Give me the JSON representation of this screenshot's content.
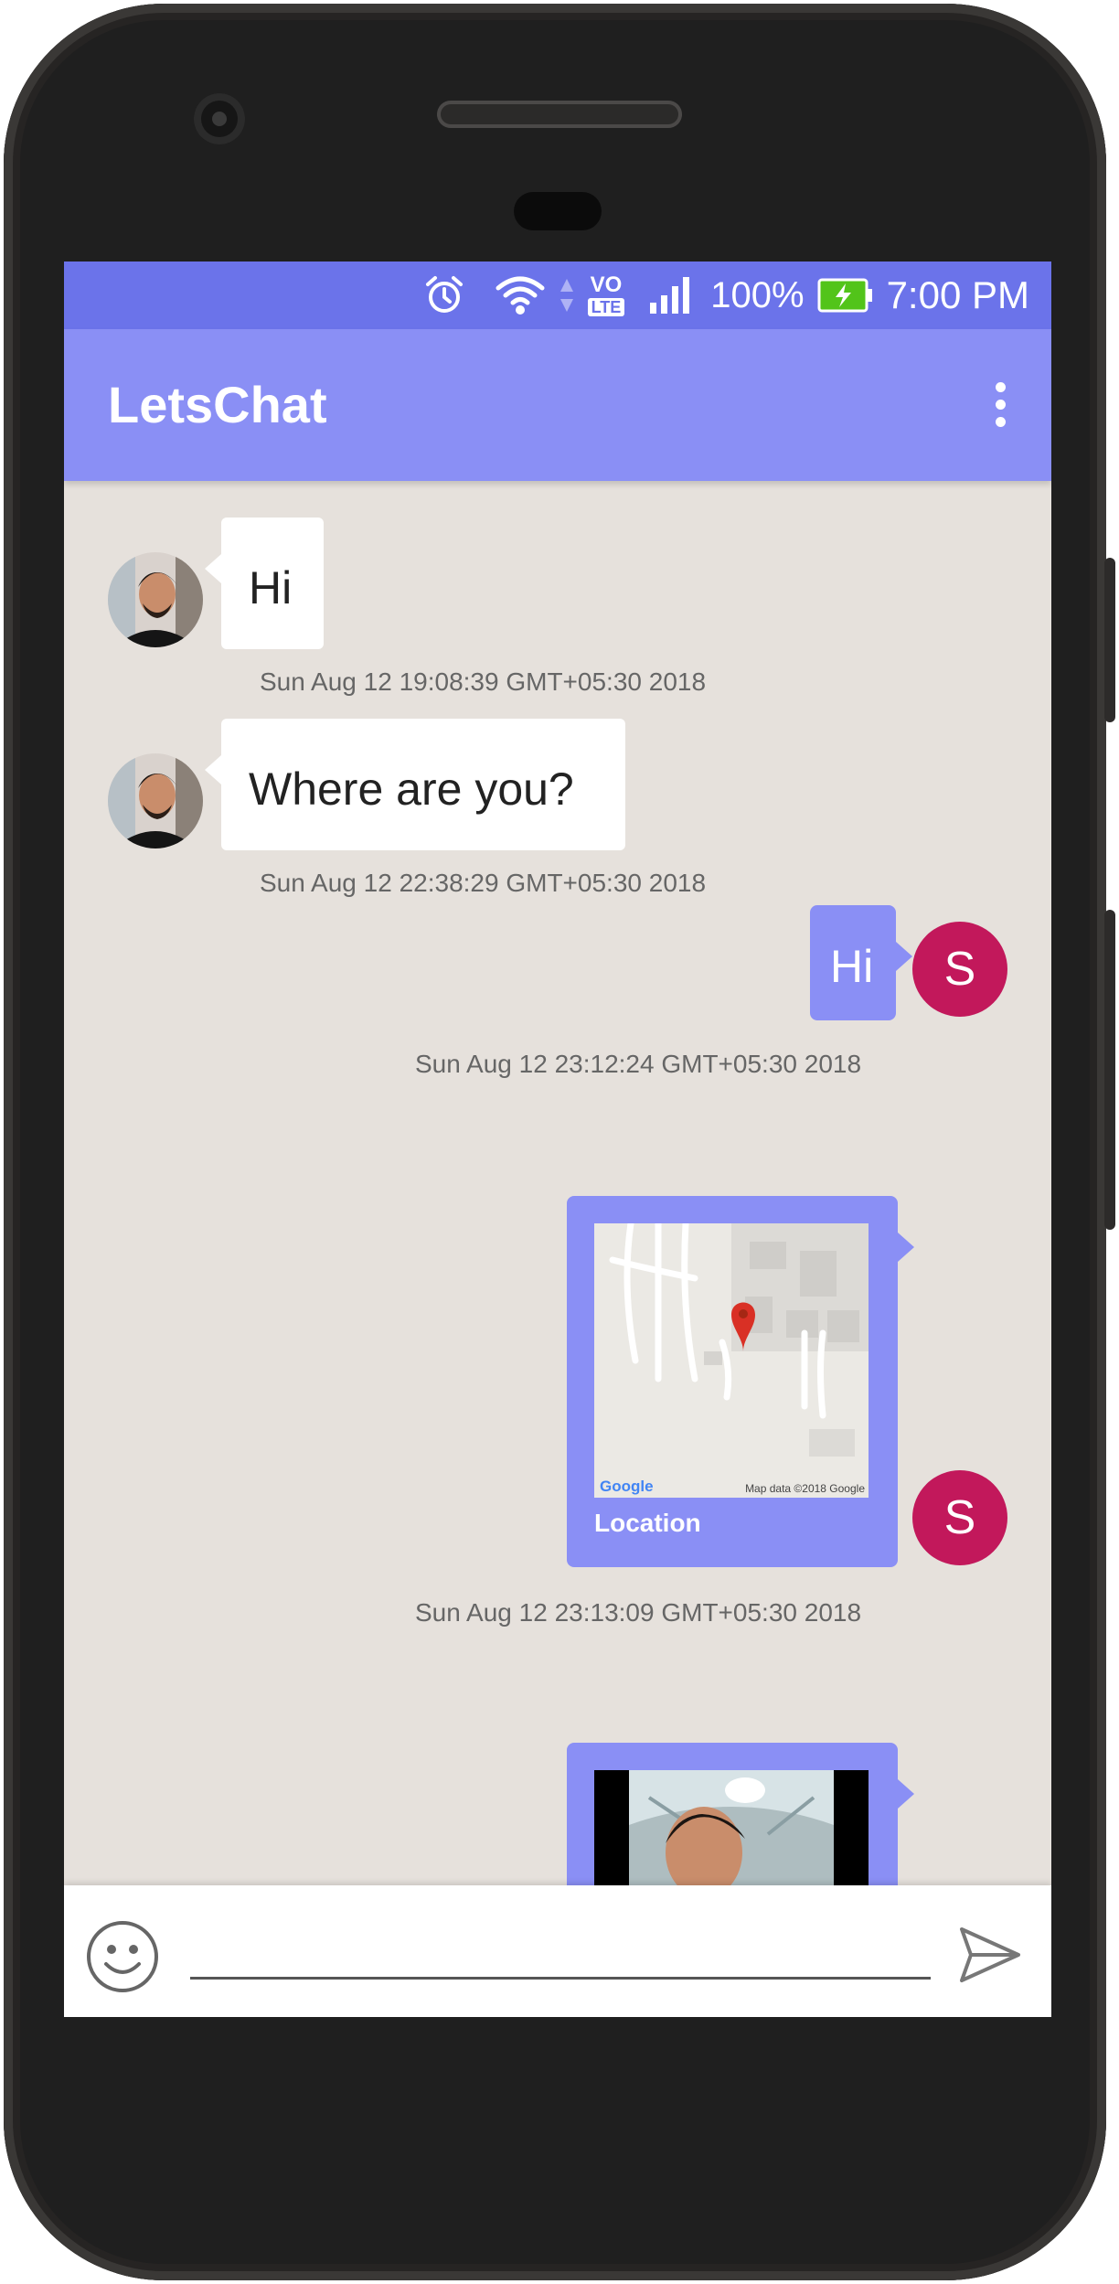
{
  "status_bar": {
    "battery": "100%",
    "time": "7:00 PM",
    "network_badge": "LTE",
    "volte_badge": "VO",
    "icons": [
      "alarm-icon",
      "wifi-icon",
      "volte-lte-icon",
      "cell-signal-icon",
      "battery-charging-icon"
    ]
  },
  "app_bar": {
    "title": "LetsChat",
    "menu_icon": "overflow-menu-icon"
  },
  "messages": [
    {
      "direction": "incoming",
      "text": "Hi",
      "timestamp": "Sun Aug 12 19:08:39 GMT+05:30 2018"
    },
    {
      "direction": "incoming",
      "text": "Where are you?",
      "timestamp": "Sun Aug 12 22:38:29 GMT+05:30 2018"
    },
    {
      "direction": "outgoing",
      "text": "Hi",
      "avatar_initial": "S",
      "timestamp": "Sun Aug 12 23:12:24 GMT+05:30 2018"
    },
    {
      "direction": "outgoing",
      "type": "location",
      "caption": "Location",
      "map_logo": "Google",
      "map_attribution": "Map data ©2018 Google",
      "avatar_initial": "S",
      "timestamp": "Sun Aug 12 23:13:09 GMT+05:30 2018"
    },
    {
      "direction": "outgoing",
      "type": "image"
    }
  ],
  "composer": {
    "emoji_icon": "emoji-icon",
    "input_value": "",
    "send_icon": "send-icon"
  },
  "colors": {
    "status_bar": "#6b73ea",
    "app_bar": "#8a8ff5",
    "outgoing_bubble": "#8a8ff5",
    "chat_background": "#e6e1dc",
    "sender_avatar": "#c2185b"
  }
}
